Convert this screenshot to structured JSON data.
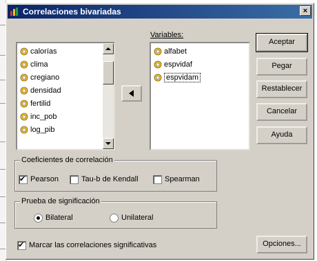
{
  "dialog": {
    "title": "Correlaciones bivariadas",
    "close_glyph": "×"
  },
  "source_list": {
    "items": [
      "calorías",
      "clima",
      "cregiano",
      "densidad",
      "fertilid",
      "inc_pob",
      "log_pib"
    ]
  },
  "variables": {
    "label": "Variables:",
    "items": [
      "alfabet",
      "espvidaf",
      "espvidam"
    ]
  },
  "move_button": {
    "glyph": "◄"
  },
  "buttons": {
    "accept": "Aceptar",
    "paste": "Pegar",
    "reset": "Restablecer",
    "cancel": "Cancelar",
    "help": "Ayuda",
    "options": "Opciones..."
  },
  "coefficients": {
    "label": "Coeficientes de correlación",
    "pearson": {
      "label": "Pearson",
      "checked": true
    },
    "kendall": {
      "label": "Tau-b de Kendall",
      "checked": false
    },
    "spearman": {
      "label": "Spearman",
      "checked": false
    }
  },
  "significance": {
    "label": "Prueba de significación",
    "bilateral": {
      "label": "Bilateral",
      "selected": true
    },
    "unilateral": {
      "label": "Unilateral",
      "selected": false
    }
  },
  "flag_significant": {
    "label": "Marcar las correlaciones significativas",
    "checked": true
  },
  "colors": {
    "titlebar_start": "#0a246a",
    "titlebar_end": "#3a6ea5",
    "face": "#d4d0c8"
  }
}
